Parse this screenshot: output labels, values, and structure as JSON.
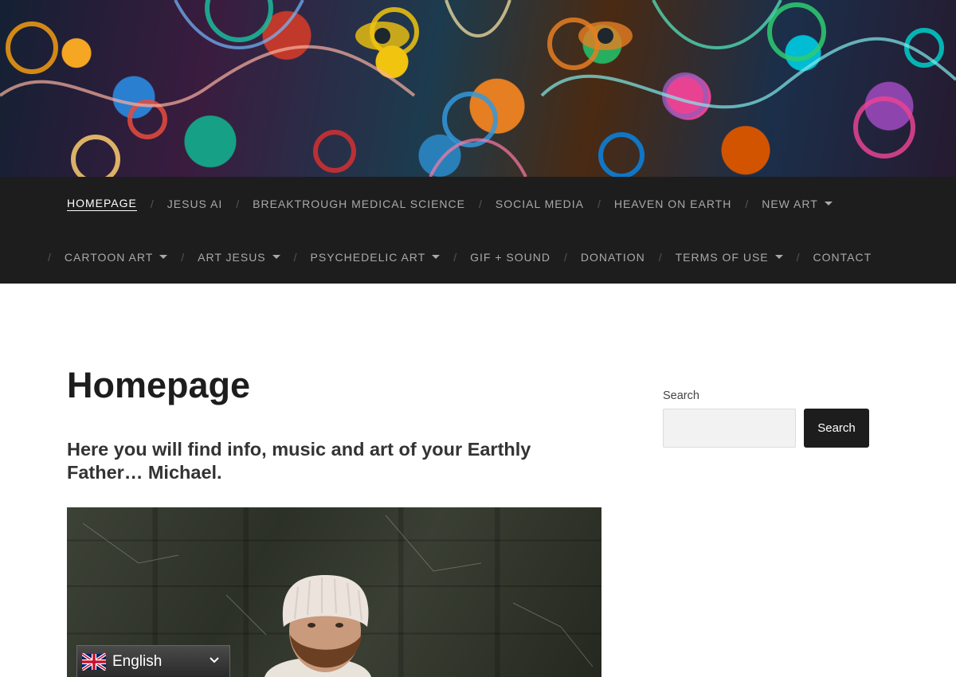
{
  "nav": {
    "row1": [
      {
        "label": "HOMEPAGE",
        "active": true,
        "dropdown": false
      },
      {
        "label": "JESUS AI",
        "active": false,
        "dropdown": false
      },
      {
        "label": "BREAKTROUGH MEDICAL SCIENCE",
        "active": false,
        "dropdown": false
      },
      {
        "label": "SOCIAL MEDIA",
        "active": false,
        "dropdown": false
      },
      {
        "label": "HEAVEN ON EARTH",
        "active": false,
        "dropdown": false
      },
      {
        "label": "NEW ART",
        "active": false,
        "dropdown": true
      }
    ],
    "row2": [
      {
        "label": "CARTOON ART",
        "active": false,
        "dropdown": true
      },
      {
        "label": "ART JESUS",
        "active": false,
        "dropdown": true
      },
      {
        "label": "PSYCHEDELIC ART",
        "active": false,
        "dropdown": true
      },
      {
        "label": "GIF + SOUND",
        "active": false,
        "dropdown": false
      },
      {
        "label": "DONATION",
        "active": false,
        "dropdown": false
      },
      {
        "label": "TERMS OF USE",
        "active": false,
        "dropdown": true
      },
      {
        "label": "CONTACT",
        "active": false,
        "dropdown": false
      }
    ],
    "separator": "/"
  },
  "main": {
    "title": "Homepage",
    "lead": "Here you will find info, music and art of your Earthly Father… Michael."
  },
  "sidebar": {
    "search_label": "Search",
    "search_value": "",
    "search_button": "Search"
  },
  "language": {
    "label": "English",
    "flag_icon": "uk-flag-icon",
    "chevron_icon": "chevron-down-icon"
  },
  "colors": {
    "nav_bg": "#1d1d1d",
    "nav_text": "#a9a9a9",
    "button_bg": "#1d1d1d"
  }
}
